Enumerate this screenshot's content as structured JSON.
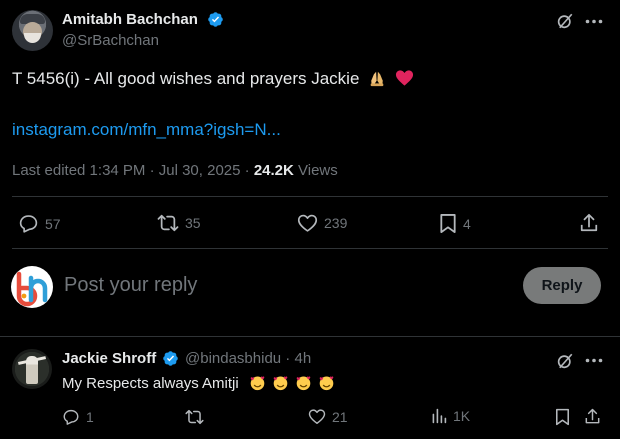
{
  "tweet": {
    "author_name": "Amitabh Bachchan",
    "author_handle": "@SrBachchan",
    "text": "T 5456(i) - All good wishes and prayers Jackie",
    "link": "instagram.com/mfn_mma?igsh=N...",
    "meta_prefix": "Last edited 1:34 PM · Jul 30, 2025 · ",
    "views_count": "24.2K",
    "views_label": " Views",
    "stats": {
      "replies": "57",
      "reposts": "35",
      "likes": "239",
      "bookmarks": "4"
    }
  },
  "reply_box": {
    "placeholder": "Post your reply",
    "button_label": "Reply"
  },
  "comment": {
    "author_name": "Jackie Shroff",
    "author_handle": "@bindasbhidu",
    "separator": " · ",
    "time": "4h",
    "text": "My Respects always Amitji",
    "stats": {
      "replies": "1",
      "likes": "21",
      "views": "1K"
    }
  },
  "colors": {
    "background": "#000000",
    "text": "#e7e9ea",
    "muted": "#71767b",
    "link": "#1d9bf0",
    "verified": "#1d9bf0",
    "divider": "#2f3336",
    "reply_button_bg": "#787a7a",
    "heart_emoji": "#e0245e"
  },
  "icons": {
    "verified": "verified-badge-icon",
    "grok": "grok-icon",
    "more": "more-options-icon",
    "reply": "reply-icon",
    "repost": "repost-icon",
    "like": "like-icon",
    "bookmark": "bookmark-icon",
    "share": "share-icon",
    "views": "views-icon"
  }
}
